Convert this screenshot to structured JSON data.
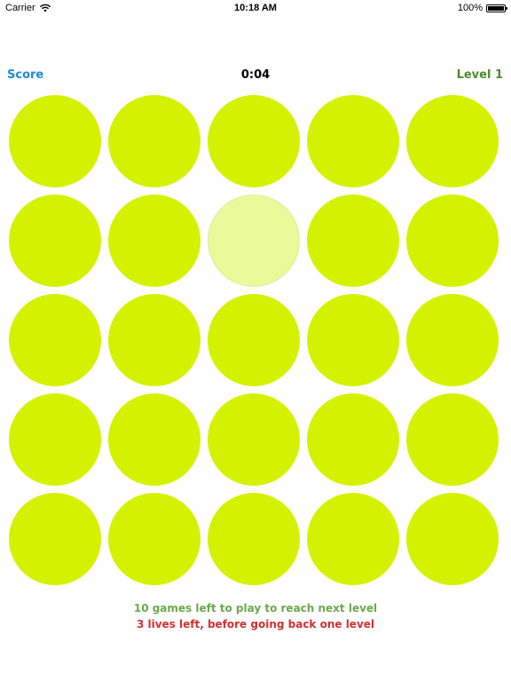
{
  "status_bar": {
    "carrier": "Carrier",
    "time": "10:18 AM",
    "battery": "100%",
    "battery_level": 1.0
  },
  "header": {
    "score_label": "Score",
    "timer": "0:04",
    "level": "Level 1"
  },
  "board": {
    "rows": 5,
    "columns": 5,
    "highlighted_index": 7,
    "cells": [
      {
        "state": "normal"
      },
      {
        "state": "normal"
      },
      {
        "state": "normal"
      },
      {
        "state": "normal"
      },
      {
        "state": "normal"
      },
      {
        "state": "normal"
      },
      {
        "state": "normal"
      },
      {
        "state": "highlighted"
      },
      {
        "state": "normal"
      },
      {
        "state": "normal"
      },
      {
        "state": "normal"
      },
      {
        "state": "normal"
      },
      {
        "state": "normal"
      },
      {
        "state": "normal"
      },
      {
        "state": "normal"
      },
      {
        "state": "normal"
      },
      {
        "state": "normal"
      },
      {
        "state": "normal"
      },
      {
        "state": "normal"
      },
      {
        "state": "normal"
      },
      {
        "state": "normal"
      },
      {
        "state": "normal"
      },
      {
        "state": "normal"
      },
      {
        "state": "normal"
      },
      {
        "state": "normal"
      }
    ]
  },
  "footer": {
    "games_left": "10 games left to play to reach next level",
    "lives_left": "3 lives left, before going back one level"
  },
  "colors": {
    "circle": "#d4f200",
    "circle_highlighted": "#eaf99a",
    "score": "#1e8ad6",
    "level": "#4b8b2c",
    "games_left": "#6aa84f",
    "lives_left": "#d32f2f"
  },
  "icons": {
    "wifi": "wifi-icon",
    "battery": "battery-icon"
  }
}
